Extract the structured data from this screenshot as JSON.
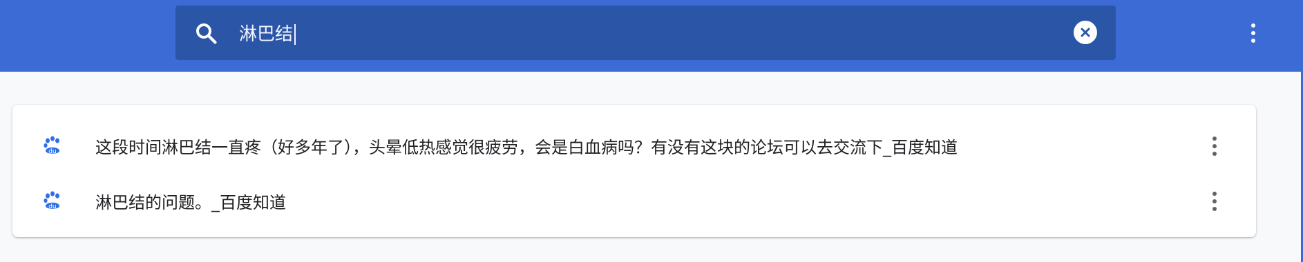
{
  "colors": {
    "header_bg": "#3c6bd6",
    "search_bg": "#2b56a8",
    "page_bg": "#f8f9fa",
    "baidu_blue": "#2e6fe8",
    "text_dark": "#202124",
    "text_light": "#f2f5ff",
    "kebab_gray": "#5f6368"
  },
  "search": {
    "value": "淋巴结",
    "icon": "search-icon",
    "clear_icon": "close-icon"
  },
  "header": {
    "menu_icon": "more-vert-icon"
  },
  "results": [
    {
      "favicon": "baidu-paw-icon",
      "title": "这段时间淋巴结一直疼（好多年了），头晕低热感觉很疲劳，会是白血病吗？有没有这块的论坛可以去交流下_百度知道",
      "menu_icon": "more-vert-icon"
    },
    {
      "favicon": "baidu-paw-icon",
      "title": "淋巴结的问题。_百度知道",
      "menu_icon": "more-vert-icon"
    }
  ]
}
